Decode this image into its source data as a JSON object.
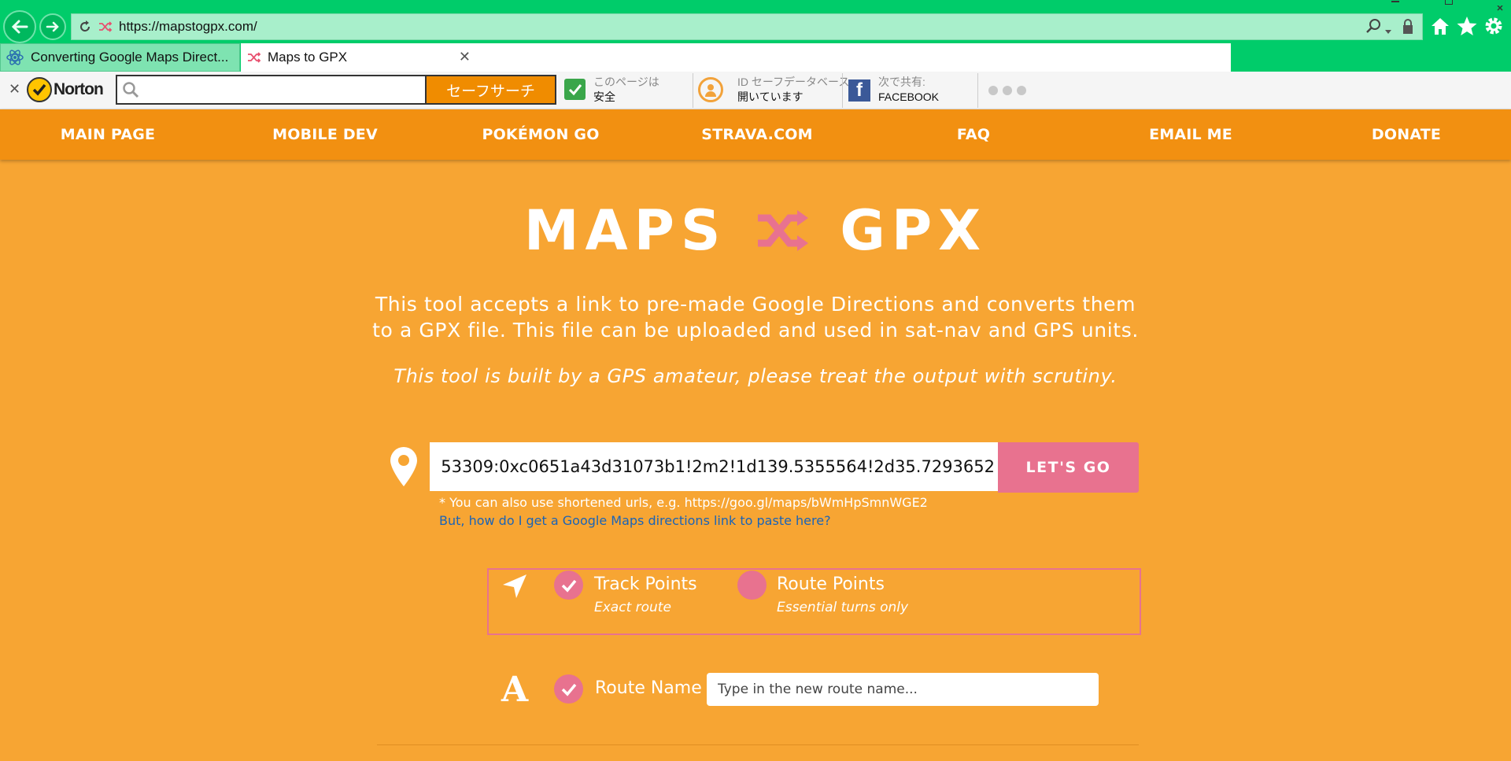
{
  "browser": {
    "url": "https://mapstogpx.com/",
    "tabs": [
      {
        "label": "Converting Google Maps Direct..."
      },
      {
        "label": "Maps to GPX"
      }
    ]
  },
  "norton": {
    "brand": "Norton",
    "search_placeholder": "",
    "safe_search_label": "セーフサーチ",
    "page_status_small": "このページは",
    "page_status_main": "安全",
    "id_safe_small": "ID セーフデータベース",
    "id_safe_main": "開いています",
    "share_small": "次で共有:",
    "share_main": "FACEBOOK"
  },
  "site_nav": {
    "items": [
      "MAIN PAGE",
      "MOBILE DEV",
      "POKÉMON GO",
      "STRAVA.COM",
      "FAQ",
      "EMAIL ME",
      "DONATE"
    ]
  },
  "hero": {
    "left_word": "MAPS",
    "right_word": "GPX",
    "description": "This tool accepts a link to pre-made Google Directions and converts them to a GPX file. This file can be uploaded and used in sat-nav and GPS units.",
    "disclaimer": "This tool is built by a GPS amateur, please treat the output with scrutiny."
  },
  "form": {
    "url_value": "53309:0xc0651a43d31073b1!2m2!1d139.5355564!2d35.7293652",
    "go_label": "LET'S GO",
    "hint": "* You can also use shortened urls, e.g. https://goo.gl/maps/bWmHpSmnWGE2",
    "help_link": "But, how do I get a Google Maps directions link to paste here?",
    "track_points": {
      "title": "Track Points",
      "subtitle": "Exact route",
      "checked": true
    },
    "route_points": {
      "title": "Route Points",
      "subtitle": "Essential turns only",
      "checked": false
    },
    "route_name": {
      "label": "Route Name",
      "placeholder": "Type in the new route name...",
      "checked": true
    }
  },
  "colors": {
    "page_bg": "#f7a533",
    "nav_bg": "#f29011",
    "accent_pink": "#e8728f",
    "browser_green": "#00cc6a"
  }
}
